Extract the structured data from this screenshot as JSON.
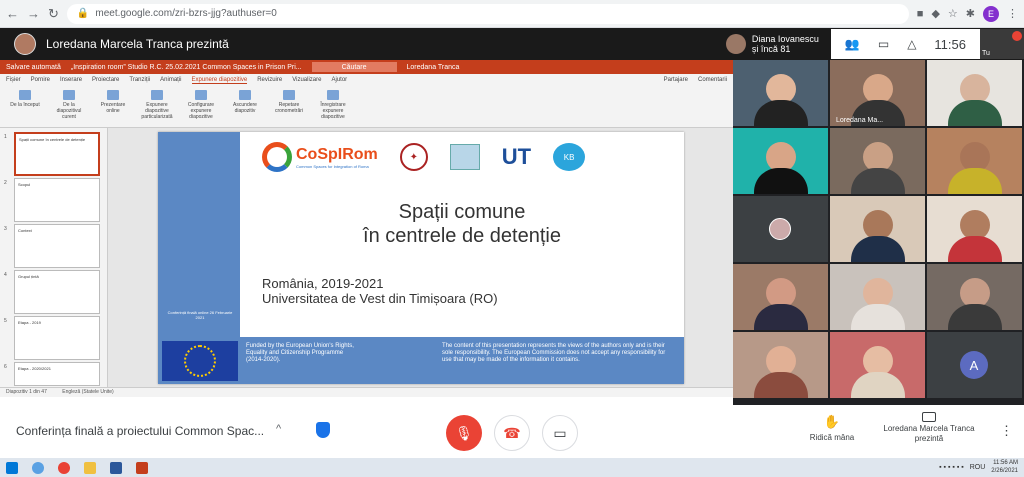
{
  "browser": {
    "url": "meet.google.com/zri-bzrs-jjg?authuser=0",
    "profile_letter": "E"
  },
  "meet_header": {
    "presenter_title": "Loredana Marcela Tranca prezintă",
    "participant_chip_name": "Diana Iovanescu",
    "participant_chip_more": "și încă 81",
    "time": "11:56",
    "self_label": "Tu"
  },
  "ppt": {
    "autosave": "Salvare automată",
    "doc_title": "„Inspiration room” Studio R.C. 25.02.2021 Common Spaces in Prison Pri...",
    "search_label": "Căutare",
    "user": "Loredana Tranca",
    "share_label": "Partajare",
    "comments_label": "Comentarii",
    "menu": [
      "Fișier",
      "Pornire",
      "Inserare",
      "Proiectare",
      "Tranziții",
      "Animații",
      "Expunere diapozitive",
      "Revizuire",
      "Vizualizare",
      "Ajutor"
    ],
    "ribbon": [
      "De la început",
      "De la diapozitivul curent",
      "Prezentare online",
      "Expunere diapozitive particularizată",
      "Configurare expunere diapozitive",
      "Ascundere diapozitiv",
      "Repetare cronometrări",
      "Înregistrare expunere diapozitive"
    ],
    "status_left": "Diapozitiv 1 din 47",
    "status_lang": "Engleză (Statele Unite)"
  },
  "thumbs": [
    {
      "num": "1",
      "text": "Spații comune în centrele de detenție"
    },
    {
      "num": "2",
      "text": "Scopul"
    },
    {
      "num": "3",
      "text": "Context"
    },
    {
      "num": "4",
      "text": "Grupul țintă"
    },
    {
      "num": "5",
      "text": "Etapa - 2019"
    },
    {
      "num": "6",
      "text": "Etapa - 2020/2021"
    }
  ],
  "slide": {
    "logo_name": "CoSpIRom",
    "logo_sub": "Common Spaces for Integration of Roma",
    "logo_ut": "UT",
    "logo_kb": "KB",
    "title_line1": "Spații comune",
    "title_line2": "în centrele de detenție",
    "info_line1": "România, 2019-2021",
    "info_line2": "Universitatea de Vest din Timișoara (RO)",
    "side_text": "Conferință finală online 26 Februarie 2021",
    "funded_text": "Funded by the European Union's Rights, Equality and Citizenship Programme (2014-2020).",
    "disclaimer": "The content of this presentation represents the views of the authors only and is their sole responsibility. The European Commission does not accept any responsibility for use that may be made of the information it contains."
  },
  "participants": {
    "featured_label": "Loredana Ma...",
    "avatar_letter": "A"
  },
  "bottom_bar": {
    "meeting_name": "Conferința finală a proiectului Common Spac...",
    "raise_hand": "Ridică mâna",
    "presenting_line1": "Loredana Marcela Tranca",
    "presenting_line2": "prezintă"
  },
  "taskbar": {
    "lang": "ROU",
    "clock_time": "11:56 AM",
    "clock_date": "2/26/2021"
  },
  "colors": {
    "end_call": "#ea4335",
    "ppt_accent": "#c43e1c",
    "meet_blue": "#1a73e8"
  }
}
